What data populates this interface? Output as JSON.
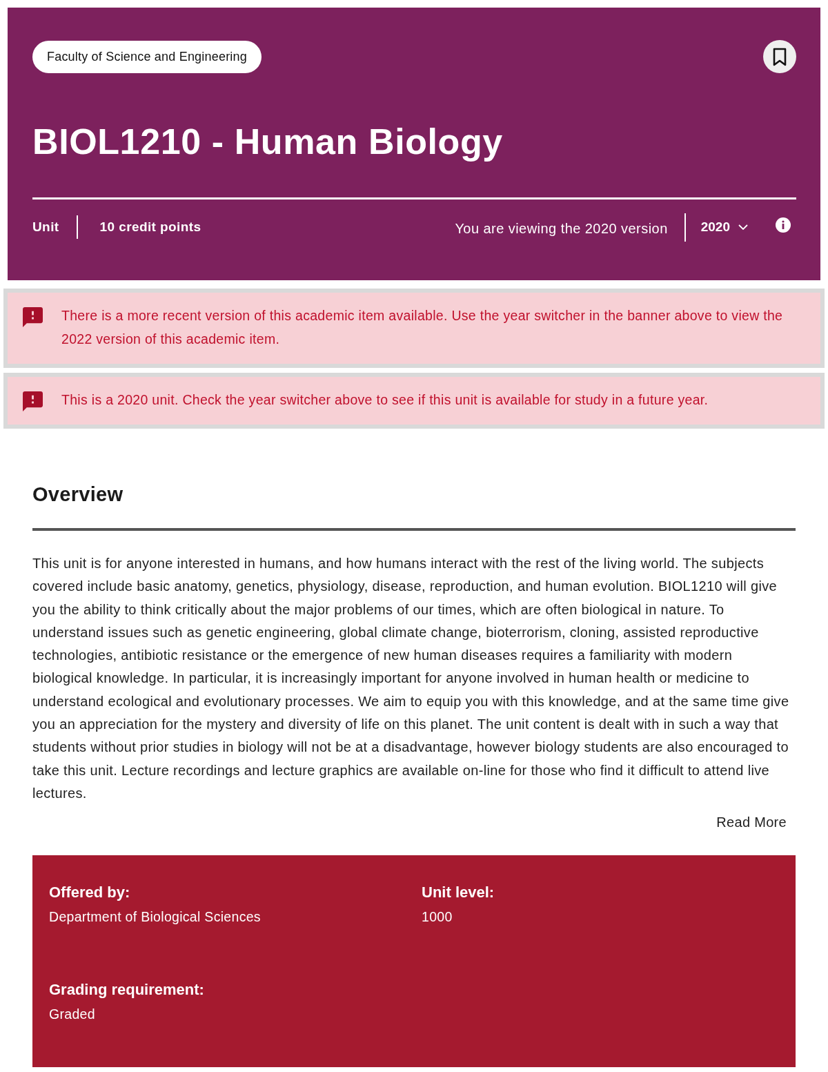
{
  "banner": {
    "faculty": "Faculty of Science and Engineering",
    "title": "BIOL1210 - Human Biology",
    "type": "Unit",
    "credits": "10 credit points",
    "version_notice": "You are viewing the 2020 version",
    "year": "2020"
  },
  "alerts": [
    {
      "text": "There is a more recent version of this academic item available. Use the year switcher in the banner above to view the 2022 version of this academic item."
    },
    {
      "text": "This is a 2020 unit. Check the year switcher above to see if this unit is available for study in a future year."
    }
  ],
  "overview": {
    "heading": "Overview",
    "body": "This unit is for anyone interested in humans, and how humans interact with the rest of the living world. The subjects covered include basic anatomy, genetics, physiology, disease, reproduction, and human evolution. BIOL1210 will give you the ability to think critically about the major problems of our times, which are often biological in nature. To understand issues such as genetic engineering, global climate change, bioterrorism, cloning, assisted reproductive technologies, antibiotic resistance or the emergence of new human diseases requires a familiarity with modern biological knowledge. In particular, it is increasingly important for anyone involved in human health or medicine to understand ecological and evolutionary processes. We aim to equip you with this knowledge, and at the same time give you an appreciation for the mystery and diversity of life on this planet. The unit content is dealt with in such a way that students without prior studies in biology will not be at a disadvantage, however biology students are also encouraged to take this unit. Lecture recordings and lecture graphics are available on-line for those who find it difficult to attend live lectures.",
    "read_more": "Read More"
  },
  "details": [
    {
      "label": "Offered by:",
      "value": "Department of Biological Sciences"
    },
    {
      "label": "Unit level:",
      "value": "1000"
    },
    {
      "label": "Grading requirement:",
      "value": "Graded"
    }
  ]
}
